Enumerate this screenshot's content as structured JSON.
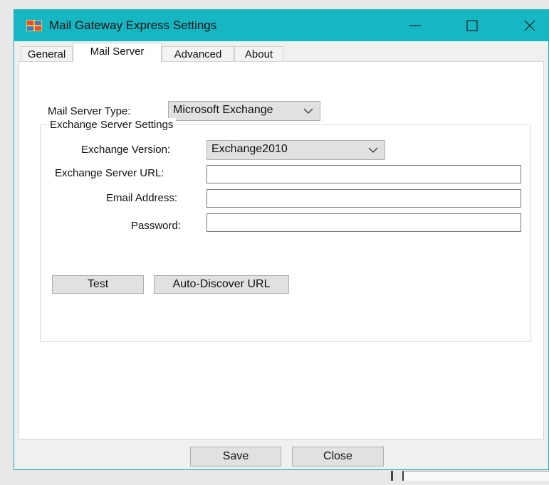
{
  "window": {
    "title": "Mail Gateway Express Settings",
    "accent_color": "#17b6c3",
    "app_icon": "mail-gateway-app-icon",
    "controls": {
      "minimize_icon": "minimize-icon",
      "maximize_icon": "maximize-icon",
      "close_icon": "close-icon"
    }
  },
  "tabs": [
    {
      "label": "General",
      "active": false
    },
    {
      "label": "Mail Server",
      "active": true
    },
    {
      "label": "Advanced",
      "active": false
    },
    {
      "label": "About",
      "active": false
    }
  ],
  "mail_server": {
    "type_label": "Mail Server Type:",
    "type_value": "Microsoft Exchange",
    "group_title": "Exchange Server Settings",
    "version_label": "Exchange Version:",
    "version_value": "Exchange2010",
    "url_label": "Exchange Server URL:",
    "url_value": "",
    "email_label": "Email Address:",
    "email_value": "",
    "password_label": "Password:",
    "password_value": "",
    "test_button": "Test",
    "autodiscover_button": "Auto-Discover URL"
  },
  "footer": {
    "save_button": "Save",
    "close_button": "Close"
  }
}
